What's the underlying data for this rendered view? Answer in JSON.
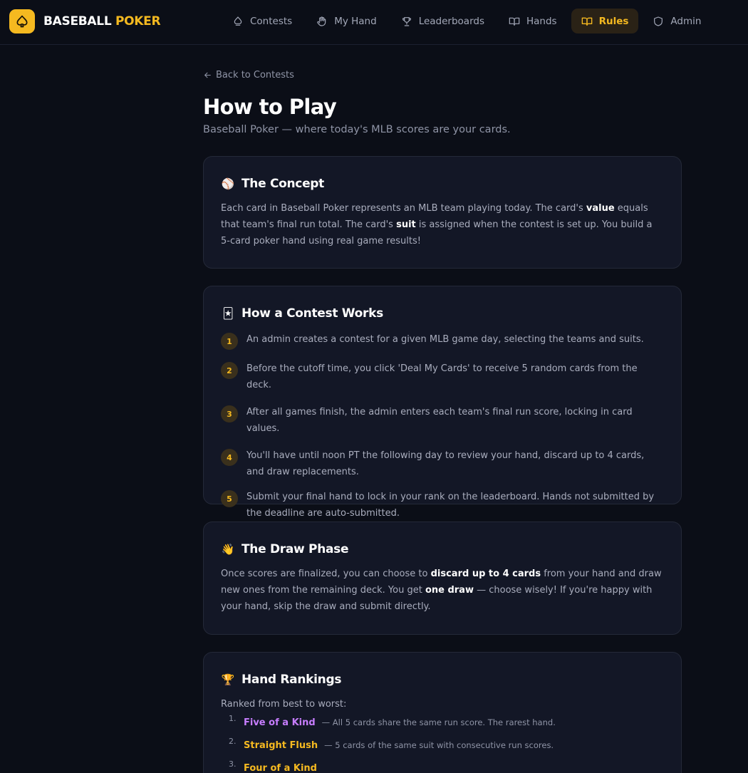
{
  "brand": {
    "name_part1": "BASEBALL",
    "name_part2": "POKER"
  },
  "nav": {
    "items": [
      {
        "label": "Contests",
        "icon": "cloud-icon",
        "active": false
      },
      {
        "label": "My Hand",
        "icon": "hand-icon",
        "active": false
      },
      {
        "label": "Leaderboards",
        "icon": "trophy-icon",
        "active": false
      },
      {
        "label": "Hands",
        "icon": "book-icon",
        "active": false
      },
      {
        "label": "Rules",
        "icon": "book-open-icon",
        "active": true
      },
      {
        "label": "Admin",
        "icon": "shield-icon",
        "active": false
      }
    ]
  },
  "page": {
    "back_label": "Back to Contests",
    "title": "How to Play",
    "subtitle": "Baseball Poker — where today's MLB scores are your cards."
  },
  "concept": {
    "emoji": "⚾",
    "title": "The Concept",
    "t1": "Each card in Baseball Poker represents an MLB team playing today. The card's ",
    "b1": "value",
    "t2": " equals that team's final run total. The card's ",
    "b2": "suit",
    "t3": " is assigned when the contest is set up. You build a 5-card poker hand using real game results!"
  },
  "contest": {
    "emoji": "🃏",
    "title": "How a Contest Works",
    "steps": [
      {
        "num": "1",
        "text": "An admin creates a contest for a given MLB game day, selecting the teams and suits."
      },
      {
        "num": "2",
        "text": "Before the cutoff time, you click 'Deal My Cards' to receive 5 random cards from the deck."
      },
      {
        "num": "3",
        "text": "After all games finish, the admin enters each team's final run score, locking in card values."
      },
      {
        "num": "4",
        "text": "You'll have until noon PT the following day to review your hand, discard up to 4 cards, and draw replacements."
      },
      {
        "num": "5",
        "text": "Submit your final hand to lock in your rank on the leaderboard. Hands not submitted by the deadline are auto-submitted."
      }
    ]
  },
  "draw": {
    "emoji": "👋",
    "title": "The Draw Phase",
    "t1": "Once scores are finalized, you can choose to ",
    "b1": "discard up to 4 cards",
    "t2": " from your hand and draw new ones from the remaining deck. You get ",
    "b2": "one draw",
    "t3": " — choose wisely! If you're happy with your hand, skip the draw and submit directly."
  },
  "rankings": {
    "emoji": "🏆",
    "title": "Hand Rankings",
    "intro": "Ranked from best to worst:",
    "items": [
      {
        "idx": "1.",
        "name": "Five of a Kind",
        "desc": "— All 5 cards share the same run score. The rarest hand.",
        "color": "#c77dff"
      },
      {
        "idx": "2.",
        "name": "Straight Flush",
        "desc": "— 5 cards of the same suit with consecutive run scores.",
        "color": "#f5b920"
      },
      {
        "idx": "3.",
        "name": "Four of a Kind",
        "desc": "",
        "color": "#f5b920"
      }
    ]
  },
  "colors": {
    "accent": "#f5b920",
    "background": "#0b0e17",
    "card": "#131726"
  }
}
